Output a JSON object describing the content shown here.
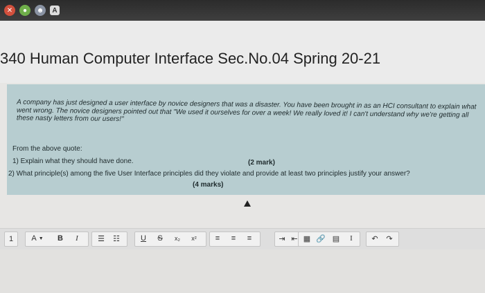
{
  "titlebar": {
    "badge_letter": "A"
  },
  "page": {
    "title": "340 Human Computer Interface Sec.No.04 Spring 20-21"
  },
  "question": {
    "paragraph": "A company has just designed a user interface by novice designers that was a disaster. You have been brought in as an HCI consultant to explain what went wrong. The novice designers pointed out that \"We used it ourselves for over a week! We really loved it! I can't understand why we're getting all these nasty letters from our users!\"",
    "from_quote": "From the above quote:",
    "q1": "1) Explain what they should have done.",
    "q1_marks": "(2 mark)",
    "q2": "2) What principle(s) among the five User Interface principles did they violate and provide at least two principles justify your answer?",
    "q2_marks": "(4 marks)"
  },
  "toolbar": {
    "para_label": "1",
    "font_color": "A",
    "bold": "B",
    "italic": "I",
    "underline": "U",
    "strike": "S",
    "subscript": "x₂",
    "superscript": "x²",
    "ltr_label": "I"
  }
}
